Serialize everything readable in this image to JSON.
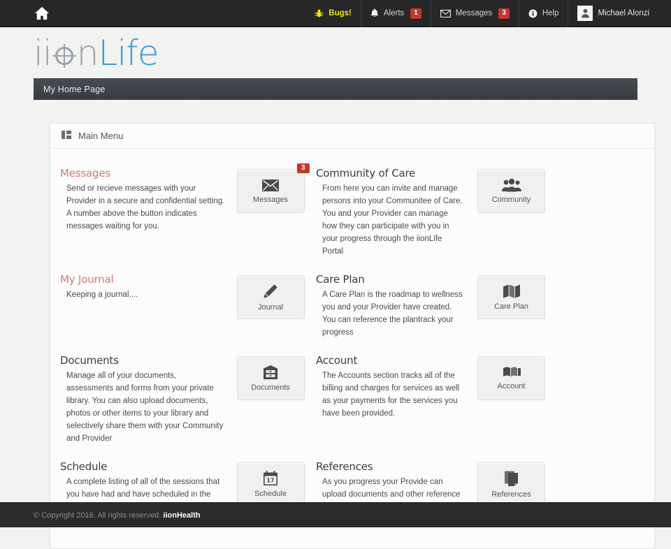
{
  "topbar": {
    "home_icon": "home-icon",
    "items": [
      {
        "id": "bugs",
        "label": "Bugs!",
        "icon": "bug-icon",
        "badge": null
      },
      {
        "id": "alerts",
        "label": "Alerts",
        "icon": "bell-icon",
        "badge": "1"
      },
      {
        "id": "messages",
        "label": "Messages",
        "icon": "envelope-icon",
        "badge": "3"
      },
      {
        "id": "help",
        "label": "Help",
        "icon": "info-icon",
        "badge": null
      }
    ],
    "user": {
      "name": "Michael Alonzi",
      "icon": "user-avatar-icon"
    },
    "colors": {
      "bugs": "#f2e400",
      "badge": "#c0392b",
      "background": "#272727"
    }
  },
  "logo": {
    "part1": "ii",
    "part2": "n",
    "part3": "Life",
    "colors": {
      "gray": "#9aa3ab",
      "blue": "#3d9bd6"
    }
  },
  "section_bar": {
    "title": "My Home Page"
  },
  "panel": {
    "title": "Main Menu",
    "icon": "dashboard-grid-icon",
    "rows": [
      {
        "left": {
          "heading": "Messages",
          "heading_style": "salmon",
          "text": "Send or recieve messages with your Provider in a secure and confidential setting. A number above the button indicates messages waiting for you."
        },
        "button_left": {
          "label": "Messages",
          "icon": "envelope-icon",
          "badge": "3"
        },
        "right": {
          "heading": "Community of Care",
          "heading_style": "dark",
          "text": "From here you can invite and manage persons into your Communitee of Care. You and your Provider can manage how they can participate with you in your progress through the iionLife Portal"
        },
        "button_right": {
          "label": "Community",
          "icon": "group-people-icon",
          "badge": null
        }
      },
      {
        "left": {
          "heading": "My Journal",
          "heading_style": "salmon",
          "text": "Keeping a journal...."
        },
        "button_left": {
          "label": "Journal",
          "icon": "pencil-icon",
          "badge": null
        },
        "right": {
          "heading": "Care Plan",
          "heading_style": "dark",
          "text": "A Care Plan is the roadmap to wellness you and your Provider have created. You can reference the plantrack your progress"
        },
        "button_right": {
          "label": "Care Plan",
          "icon": "map-icon",
          "badge": null
        }
      },
      {
        "left": {
          "heading": "Documents",
          "heading_style": "dark",
          "text": "Manage all of your documents, assessments and forms from your private library. You can also upload documents, photos or other items to your library and selectively share them with your Community and Provider"
        },
        "button_left": {
          "label": "Documents",
          "icon": "file-cabinet-icon",
          "badge": null
        },
        "right": {
          "heading": "Account",
          "heading_style": "dark",
          "text": "The Accounts section tracks all of the billing and charges for services as well as your payments for the services you have been provided."
        },
        "button_right": {
          "label": "Account",
          "icon": "money-icon",
          "badge": null
        }
      },
      {
        "left": {
          "heading": "Schedule",
          "heading_style": "dark",
          "text": "A complete listing of all of the sessions that you have had and have scheduled in the future with your Provider"
        },
        "button_left": {
          "label": "Schedule",
          "icon": "calendar-icon",
          "badge": null
        },
        "right": {
          "heading": "References",
          "heading_style": "dark",
          "text": "As you progress your Provide can upload documents and other reference materials to help you manage and understand your care."
        },
        "button_right": {
          "label": "References",
          "icon": "book-copy-icon",
          "badge": null
        }
      }
    ]
  },
  "footer": {
    "copyright": "© Copyright 2016. All rights reserved.",
    "brand": "iionHealth"
  }
}
